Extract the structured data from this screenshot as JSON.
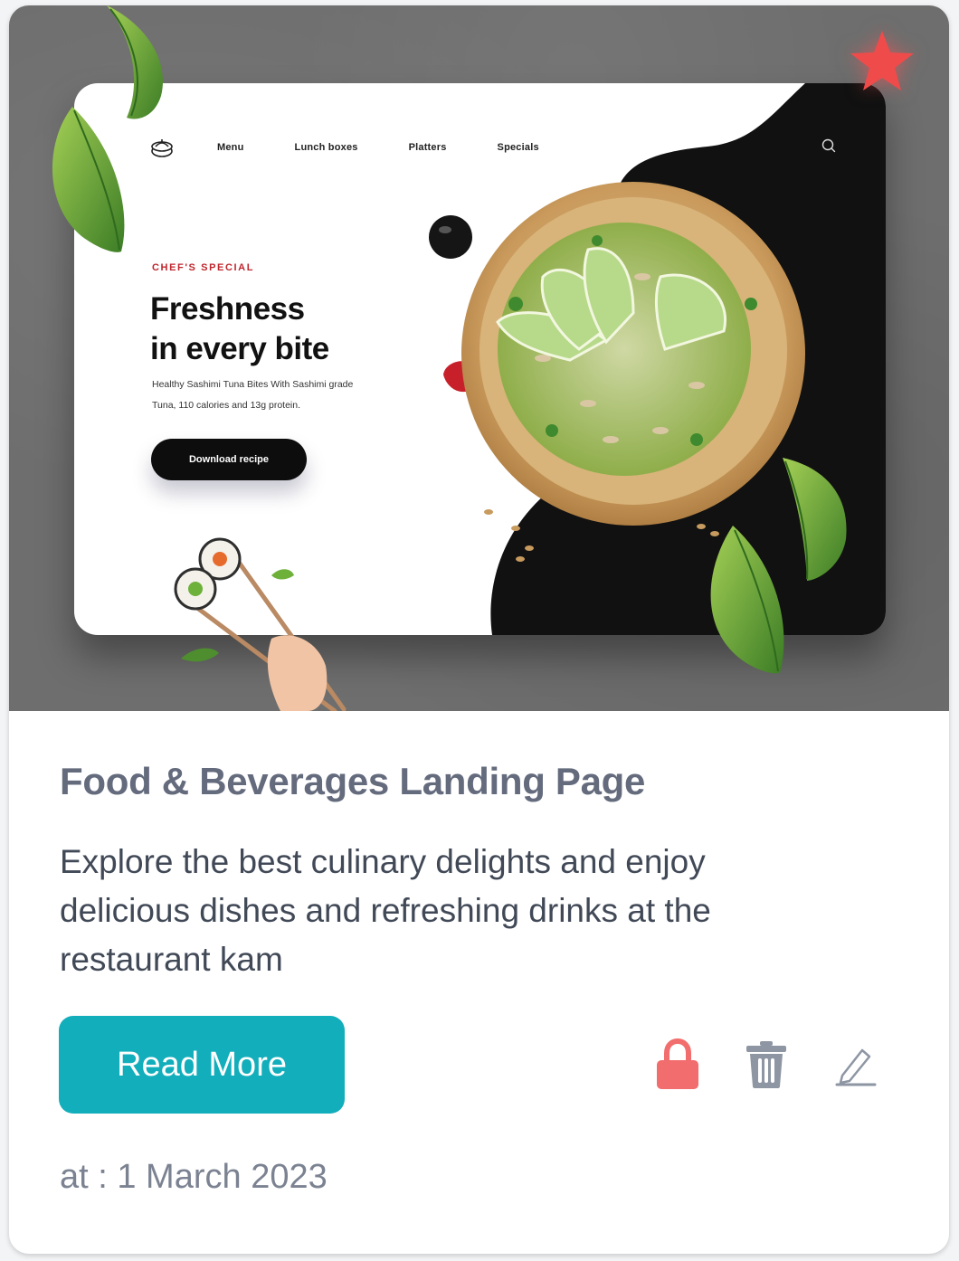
{
  "card": {
    "favorite_icon": "star-icon",
    "favorite_color": "#f04b4b",
    "title": "Food & Beverages Landing Page",
    "description": "Explore the best culinary delights and enjoy delicious dishes and refreshing drinks at the restaurant kam",
    "read_more_label": "Read More",
    "actions": [
      {
        "icon": "lock-icon",
        "color": "#f26d6d"
      },
      {
        "icon": "trash-icon",
        "color": "#8e96a3"
      },
      {
        "icon": "edit-icon",
        "color": "#8e96a3"
      }
    ],
    "date": "at : 1 March 2023",
    "accent_color": "#12aebb"
  },
  "preview": {
    "nav": [
      "Menu",
      "Lunch boxes",
      "Platters",
      "Specials"
    ],
    "logo_icon": "dumpling-steamer-logo",
    "search_icon": "search-icon",
    "eyebrow": "CHEF'S SPECIAL",
    "headline_line1": "Freshness",
    "headline_line2": "in every bite",
    "sub_line1": "Healthy Sashimi Tuna Bites With Sashimi grade",
    "sub_line2": "Tuna, 110 calories and 13g protein.",
    "button_label": "Download recipe"
  }
}
